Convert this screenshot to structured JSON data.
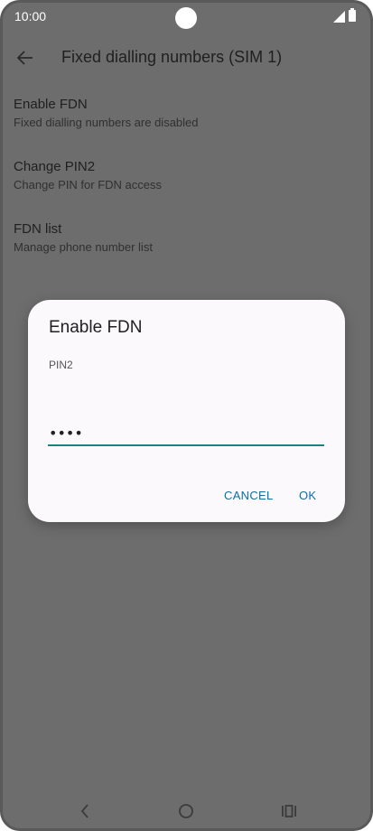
{
  "status_bar": {
    "time": "10:00"
  },
  "app_bar": {
    "title": "Fixed dialling numbers (SIM 1)"
  },
  "settings": [
    {
      "title": "Enable FDN",
      "subtitle": "Fixed dialling numbers are disabled"
    },
    {
      "title": "Change PIN2",
      "subtitle": "Change PIN for FDN access"
    },
    {
      "title": "FDN list",
      "subtitle": "Manage phone number list"
    }
  ],
  "dialog": {
    "title": "Enable FDN",
    "label": "PIN2",
    "input_value": "••••",
    "cancel_label": "CANCEL",
    "ok_label": "OK"
  },
  "icons": {
    "back": "arrow-left-icon",
    "nav_back": "chevron-left-icon",
    "nav_home": "circle-home-icon",
    "nav_recents": "recents-bars-icon"
  },
  "colors": {
    "accent": "#16857c",
    "button_text": "#0b6ea5",
    "scrim_background": "#6d6d6d",
    "dialog_background": "#fbf9fc"
  }
}
